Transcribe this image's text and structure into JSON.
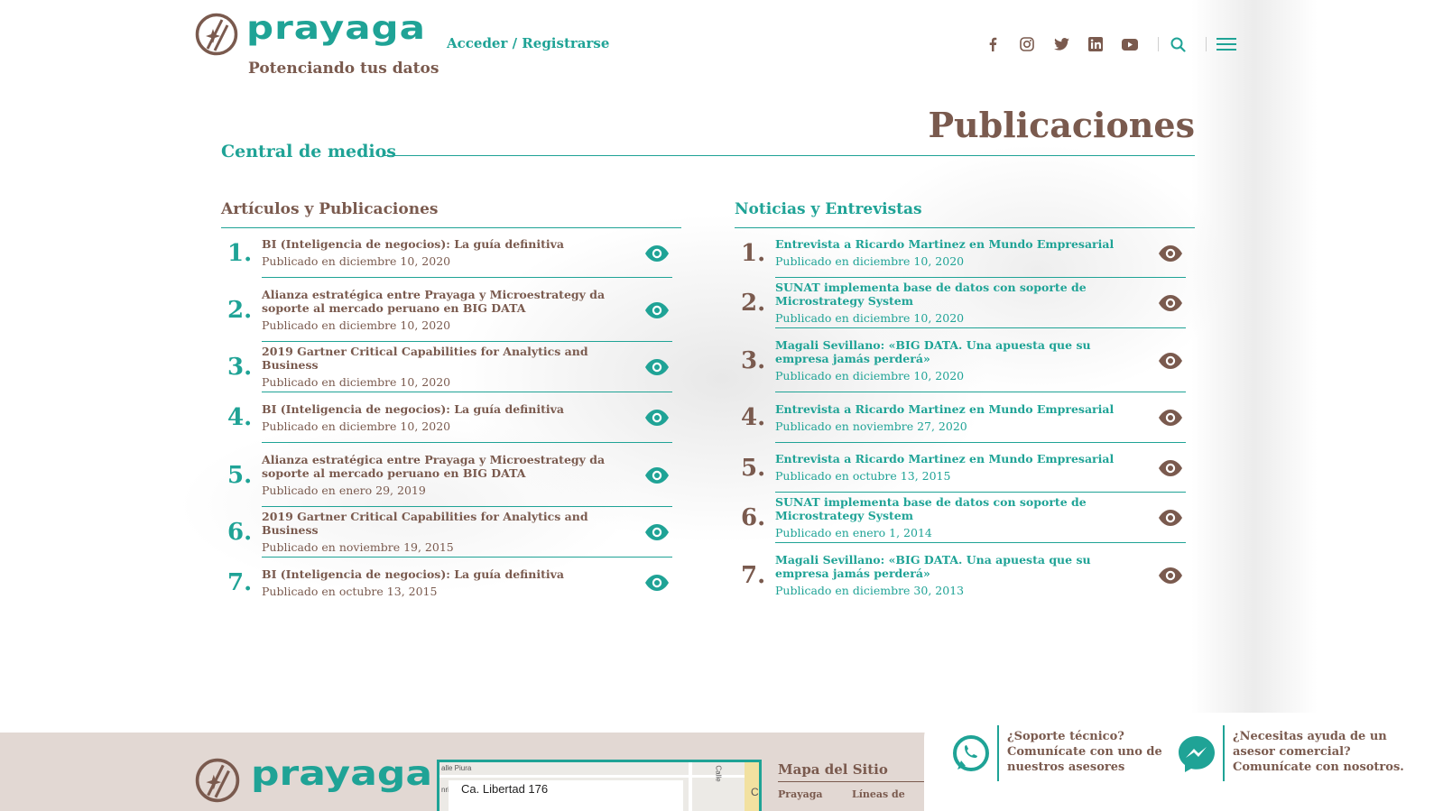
{
  "header": {
    "logo_text": "prayaga",
    "tagline": "Potenciando tus datos",
    "login_link": "Acceder / Registrarse",
    "social_icons": [
      "facebook-icon",
      "instagram-icon",
      "twitter-icon",
      "linkedin-icon",
      "youtube-icon"
    ],
    "search_icon": "search-icon",
    "menu_icon": "hamburger-menu-icon"
  },
  "page": {
    "title": "Publicaciones",
    "section_label": "Central de medios"
  },
  "articles": {
    "title": "Artículos y Publicaciones",
    "items": [
      {
        "num": "1.",
        "title": "BI (Inteligencia de negocios): La guía definitiva",
        "date": "Publicado en diciembre 10, 2020"
      },
      {
        "num": "2.",
        "title": "Alianza estratégica entre Prayaga y Microestrategy da soporte al mercado peruano en BIG DATA",
        "date": "Publicado en diciembre 10, 2020"
      },
      {
        "num": "3.",
        "title": "2019 Gartner Critical Capabilities for Analytics and Business",
        "date": "Publicado en diciembre 10, 2020"
      },
      {
        "num": "4.",
        "title": "BI (Inteligencia de negocios): La guía definitiva",
        "date": "Publicado en diciembre 10, 2020"
      },
      {
        "num": "5.",
        "title": "Alianza estratégica entre Prayaga y Microestrategy da soporte al mercado peruano en BIG DATA",
        "date": "Publicado en enero 29, 2019"
      },
      {
        "num": "6.",
        "title": "2019 Gartner Critical Capabilities for Analytics and Business",
        "date": "Publicado en noviembre 19, 2015"
      },
      {
        "num": "7.",
        "title": "BI (Inteligencia de negocios): La guía definitiva",
        "date": "Publicado en octubre 13, 2015"
      }
    ]
  },
  "news": {
    "title": "Noticias y Entrevistas",
    "items": [
      {
        "num": "1.",
        "title": "Entrevista a Ricardo Martinez en Mundo Empresarial",
        "date": "Publicado en diciembre 10, 2020"
      },
      {
        "num": "2.",
        "title": "SUNAT implementa base de datos con soporte de Microstrategy System",
        "date": "Publicado en diciembre 10, 2020"
      },
      {
        "num": "3.",
        "title": "Magali Sevillano: «BIG DATA. Una apuesta que su empresa jamás perderá»",
        "date": "Publicado en diciembre 10, 2020"
      },
      {
        "num": "4.",
        "title": "Entrevista a Ricardo Martinez en Mundo Empresarial",
        "date": "Publicado en noviembre 27, 2020"
      },
      {
        "num": "5.",
        "title": "Entrevista a Ricardo Martinez en Mundo Empresarial",
        "date": "Publicado en octubre 13, 2015"
      },
      {
        "num": "6.",
        "title": "SUNAT implementa base de datos con soporte de Microstrategy System",
        "date": "Publicado en enero 1, 2014"
      },
      {
        "num": "7.",
        "title": "Magali Sevillano: «BIG DATA. Una apuesta que su empresa jamás perderá»",
        "date": "Publicado en diciembre 30, 2013"
      }
    ]
  },
  "footer": {
    "logo_text": "prayaga",
    "map": {
      "address": "Ca. Libertad 176",
      "street_label_top": "alle Piura",
      "street_label_side": "Calle",
      "corner_letter": "C",
      "left_fragment": "nri"
    },
    "sitemap_title": "Mapa del Sitio",
    "sitemap_links": [
      "Prayaga",
      "Líneas de"
    ]
  },
  "contact": {
    "support": {
      "icon": "whatsapp-icon",
      "lines": [
        "¿Soporte técnico?",
        "Comunícate con uno de",
        "nuestros asesores"
      ]
    },
    "sales": {
      "icon": "messenger-icon",
      "lines": [
        "¿Necesitas ayuda de un",
        "asesor comercial?",
        "Comunícate con nosotros."
      ]
    }
  },
  "colors": {
    "teal": "#1fa396",
    "brown": "#7a5a4e",
    "footer_bg": "#e2d8d3"
  }
}
